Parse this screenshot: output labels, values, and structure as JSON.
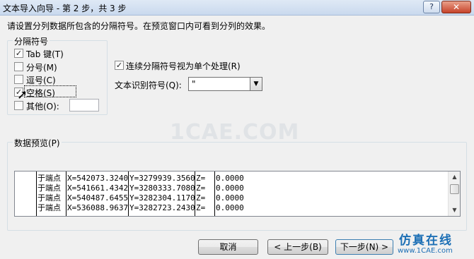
{
  "window": {
    "title": "文本导入向导 - 第 2 步，共 3 步",
    "help_label": "?",
    "close_label": "✕"
  },
  "instruction": "请设置分列数据所包含的分隔符号。在预览窗口内可看到分列的效果。",
  "delimiters": {
    "group_label": "分隔符号",
    "tab": {
      "label": "Tab 键(T)",
      "checked": true,
      "mark": "✓"
    },
    "semicolon": {
      "label": "分号(M)",
      "checked": false,
      "mark": ""
    },
    "comma": {
      "label": "逗号(C)",
      "checked": false,
      "mark": ""
    },
    "space": {
      "label": "空格(S)",
      "checked": true,
      "mark": "✓"
    },
    "other": {
      "label": "其他(O):",
      "checked": false,
      "mark": "",
      "value": ""
    }
  },
  "consecutive": {
    "label": "连续分隔符号视为单个处理(R)",
    "checked": true,
    "mark": "✓"
  },
  "qualifier": {
    "label": "文本识别符号(Q):",
    "value": "\""
  },
  "watermark": "1CAE.COM",
  "preview": {
    "label": "数据预览(P)",
    "rows": [
      [
        "于端点",
        "X=542073.3240",
        "Y=3279939.3560",
        "Z=",
        "0.0000"
      ],
      [
        "于端点",
        "X=541661.4342",
        "Y=3280333.7080",
        "Z=",
        "0.0000"
      ],
      [
        "于端点",
        "X=540487.6455",
        "Y=3282304.1170",
        "Z=",
        "0.0000"
      ],
      [
        "于端点",
        "X=536088.9637",
        "Y=3282723.2430",
        "Z=",
        "0.0000"
      ]
    ]
  },
  "buttons": {
    "cancel": "取消",
    "back": "< 上一步(B)",
    "next": "下一步(N) >"
  },
  "logo": {
    "top": "仿真在线",
    "bottom": "www.1CAE.com"
  }
}
